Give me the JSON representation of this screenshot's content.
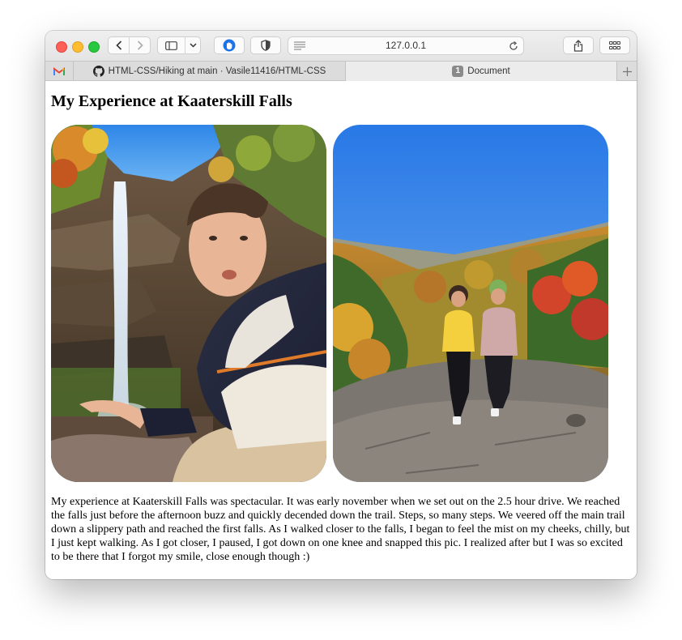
{
  "browser": {
    "url": "127.0.0.1",
    "tabs": [
      {
        "label": "",
        "icon": "gmail-icon"
      },
      {
        "label": "HTML-CSS/Hiking at main · Vasile11416/HTML-CSS",
        "icon": "github-icon"
      },
      {
        "label": "Document",
        "badge": "1",
        "active": true
      }
    ]
  },
  "page": {
    "heading": "My Experience at Kaaterskill Falls",
    "photos": [
      {
        "subject": "man posing in front of a waterfall"
      },
      {
        "subject": "two people standing on rocks above an autumn valley"
      }
    ],
    "paragraph": "My experience at Kaaterskill Falls was spectacular. It was early november when we set out on the 2.5 hour drive. We reached the falls just before the afternoon buzz and quickly decended down the trail. Steps, so many steps. We veered off the main trail down a slippery path and reached the first falls. As I walked closer to the falls, I began to feel the mist on my cheeks, chilly, but I just kept walking. As I got closer, I paused, I got down on one knee and snapped this pic. I realized after but I was so excited to be there that I forgot my smile, close enough though :)"
  },
  "colors": {
    "close": "#fe5f57",
    "minimize": "#febc2e",
    "zoom": "#28c840",
    "privacy_accent": "#1a73e8"
  }
}
